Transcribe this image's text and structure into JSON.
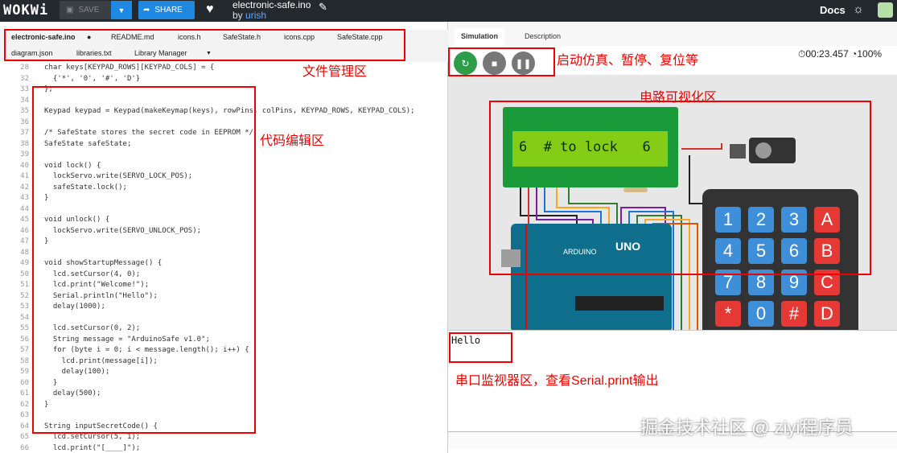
{
  "topbar": {
    "logo": "WOKWi",
    "save": "SAVE",
    "share": "SHARE",
    "project": "electronic-safe.ino",
    "by": "by",
    "user": "urish",
    "docs": "Docs"
  },
  "editor": {
    "tabs": [
      "electronic-safe.ino",
      "README.md",
      "icons.h",
      "SafeState.h",
      "icons.cpp",
      "SafeState.cpp"
    ],
    "tabs2": [
      "diagram.json",
      "libraries.txt",
      "Library Manager"
    ],
    "lines": [
      {
        "n": "28",
        "t": "char keys[KEYPAD_ROWS][KEYPAD_COLS] = {"
      },
      {
        "n": "32",
        "t": "  {'*', '0', '#', 'D'}"
      },
      {
        "n": "33",
        "t": "};"
      },
      {
        "n": "34",
        "t": ""
      },
      {
        "n": "35",
        "t": "Keypad keypad = Keypad(makeKeymap(keys), rowPins, colPins, KEYPAD_ROWS, KEYPAD_COLS);"
      },
      {
        "n": "36",
        "t": ""
      },
      {
        "n": "37",
        "t": "/* SafeState stores the secret code in EEPROM */"
      },
      {
        "n": "38",
        "t": "SafeState safeState;"
      },
      {
        "n": "39",
        "t": ""
      },
      {
        "n": "40",
        "t": "void lock() {"
      },
      {
        "n": "41",
        "t": "  lockServo.write(SERVO_LOCK_POS);"
      },
      {
        "n": "42",
        "t": "  safeState.lock();"
      },
      {
        "n": "43",
        "t": "}"
      },
      {
        "n": "44",
        "t": ""
      },
      {
        "n": "45",
        "t": "void unlock() {"
      },
      {
        "n": "46",
        "t": "  lockServo.write(SERVO_UNLOCK_POS);"
      },
      {
        "n": "47",
        "t": "}"
      },
      {
        "n": "48",
        "t": ""
      },
      {
        "n": "49",
        "t": "void showStartupMessage() {"
      },
      {
        "n": "50",
        "t": "  lcd.setCursor(4, 0);"
      },
      {
        "n": "51",
        "t": "  lcd.print(\"Welcome!\");"
      },
      {
        "n": "52",
        "t": "  Serial.println(\"Hello\");"
      },
      {
        "n": "53",
        "t": "  delay(1000);"
      },
      {
        "n": "54",
        "t": ""
      },
      {
        "n": "55",
        "t": "  lcd.setCursor(0, 2);"
      },
      {
        "n": "56",
        "t": "  String message = \"ArduinoSafe v1.0\";"
      },
      {
        "n": "57",
        "t": "  for (byte i = 0; i < message.length(); i++) {"
      },
      {
        "n": "58",
        "t": "    lcd.print(message[i]);"
      },
      {
        "n": "59",
        "t": "    delay(100);"
      },
      {
        "n": "60",
        "t": "  }"
      },
      {
        "n": "61",
        "t": "  delay(500);"
      },
      {
        "n": "62",
        "t": "}"
      },
      {
        "n": "63",
        "t": ""
      },
      {
        "n": "64",
        "t": "String inputSecretCode() {"
      },
      {
        "n": "65",
        "t": "  lcd.setCursor(5, 1);"
      },
      {
        "n": "66",
        "t": "  lcd.print(\"[____]\");"
      }
    ]
  },
  "sim": {
    "tab_sim": "Simulation",
    "tab_desc": "Description",
    "timer": "00:23.457",
    "speed": "100%",
    "lcd": "6  # to lock   6",
    "board": "UNO",
    "brand": "ARDUINO",
    "serial": "Hello",
    "keys": [
      "1",
      "2",
      "3",
      "A",
      "4",
      "5",
      "6",
      "B",
      "7",
      "8",
      "9",
      "C",
      "*",
      "0",
      "#",
      "D"
    ]
  },
  "notes": {
    "files": "文件管理区",
    "controls": "启动仿真、暂停、复位等",
    "code": "代码编辑区",
    "circuit": "电路可视化区",
    "serial": "串口监视器区，查看Serial.print输出"
  },
  "watermark": "掘金技术社区 @ ziyi程序员"
}
